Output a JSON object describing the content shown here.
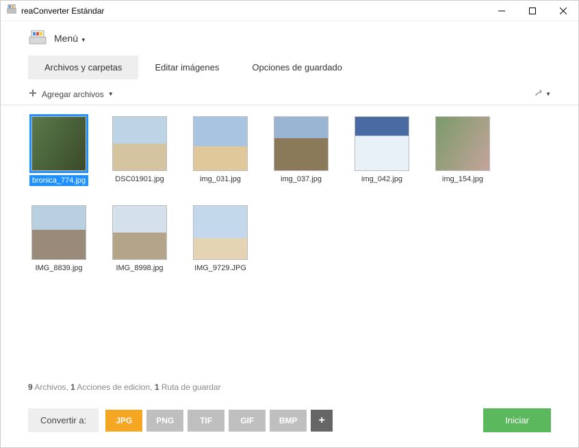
{
  "window": {
    "title": "reaConverter Estándar"
  },
  "menu": {
    "label": "Menú"
  },
  "tabs": [
    {
      "label": "Archivos y carpetas",
      "active": true
    },
    {
      "label": "Editar imágenes",
      "active": false
    },
    {
      "label": "Opciones de guardado",
      "active": false
    }
  ],
  "toolbar": {
    "add_files": "Agregar archivos"
  },
  "files": [
    {
      "name": "bronica_774.jpg",
      "selected": true,
      "art": "art1"
    },
    {
      "name": "DSC01901.jpg",
      "selected": false,
      "art": "art2"
    },
    {
      "name": "img_031.jpg",
      "selected": false,
      "art": "art3"
    },
    {
      "name": "img_037.jpg",
      "selected": false,
      "art": "art4"
    },
    {
      "name": "img_042.jpg",
      "selected": false,
      "art": "art5"
    },
    {
      "name": "img_154.jpg",
      "selected": false,
      "art": "art6"
    },
    {
      "name": "IMG_8839.jpg",
      "selected": false,
      "art": "art7"
    },
    {
      "name": "IMG_8998.jpg",
      "selected": false,
      "art": "art8"
    },
    {
      "name": "IMG_9729.JPG",
      "selected": false,
      "art": "art9"
    }
  ],
  "status": {
    "files_count": "9",
    "files_word": "Archivos,",
    "actions_count": "1",
    "actions_word": "Acciones de edicion,",
    "paths_count": "1",
    "paths_word": "Ruta de guardar"
  },
  "footer": {
    "convert_label": "Convertir a:",
    "formats": [
      {
        "label": "JPG",
        "active": true
      },
      {
        "label": "PNG",
        "active": false
      },
      {
        "label": "TIF",
        "active": false
      },
      {
        "label": "GIF",
        "active": false
      },
      {
        "label": "BMP",
        "active": false
      }
    ],
    "start": "Iniciar"
  }
}
